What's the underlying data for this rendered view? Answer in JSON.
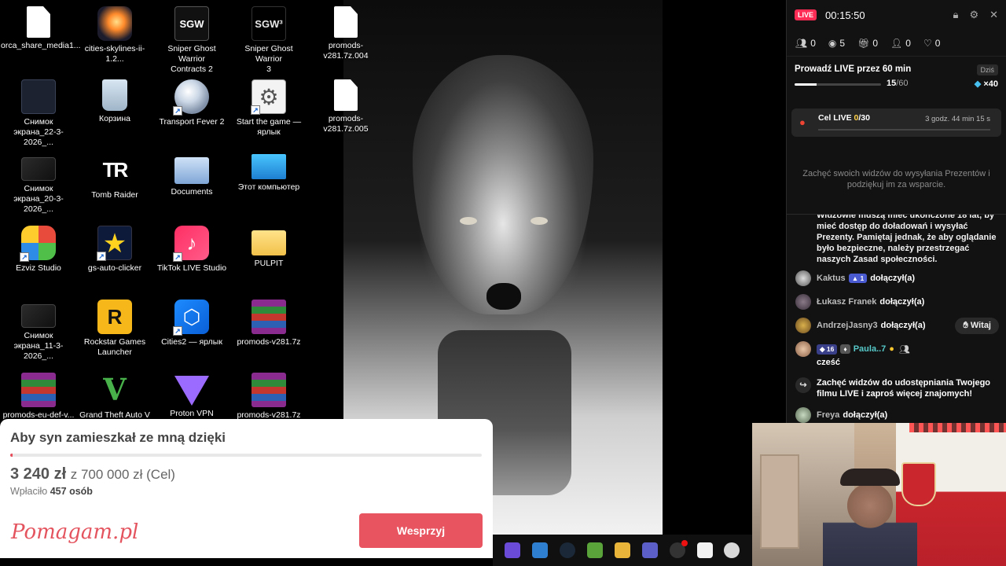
{
  "desktop": {
    "icons": [
      {
        "label": "orca_share_media1..."
      },
      {
        "label": "cities-skylines-ii-1.2..."
      },
      {
        "label": "Sniper Ghost Warrior\nContracts 2",
        "badge": "SGW"
      },
      {
        "label": "Sniper Ghost Warrior\n3",
        "badge": "SGW³"
      },
      {
        "label": "promods-v281.7z.004"
      },
      {
        "label": "Снимок\nэкрана_22-3-2026_..."
      },
      {
        "label": "Корзина"
      },
      {
        "label": "Transport Fever 2"
      },
      {
        "label": "Start the game —\nярлык"
      },
      {
        "label": "promods-v281.7z.005"
      },
      {
        "label": "Снимок\nэкрана_20-3-2026_..."
      },
      {
        "label": "Tomb Raider",
        "badge": "TR"
      },
      {
        "label": "Documents"
      },
      {
        "label": "Этот компьютер"
      },
      {
        "label": "Ezviz Studio"
      },
      {
        "label": "gs-auto-clicker"
      },
      {
        "label": "TikTok LIVE Studio"
      },
      {
        "label": "PULPIT"
      },
      {
        "label": "Снимок\nэкрана_11-3-2026_..."
      },
      {
        "label": "Rockstar Games\nLauncher",
        "badge": "R"
      },
      {
        "label": "Cities2 — ярлык"
      },
      {
        "label": "promods-v281.7z"
      },
      {
        "label": "promods-eu-def-v..."
      },
      {
        "label": "Grand Theft Auto V",
        "badge": "V"
      },
      {
        "label": "Proton VPN"
      },
      {
        "label": "promods-v281.7z"
      }
    ]
  },
  "fundraiser": {
    "title": "Aby syn zamieszkał ze mną dzięki",
    "raised": "3 240 zł",
    "goal": "z 700 000 zł (Cel)",
    "donors_prefix": "Wpłaciło",
    "donors_count": "457",
    "donors_suffix": "osób",
    "progress_fraction": 0.0046,
    "logo": "Pomagam.pl",
    "button": "Wesprzyj",
    "accent": "#e85460"
  },
  "live_panel": {
    "badge": "LIVE",
    "timer": "00:15:50",
    "stats": [
      {
        "icon": "users-icon",
        "value": "0"
      },
      {
        "icon": "eye-icon",
        "value": "5"
      },
      {
        "icon": "gift-icon",
        "value": "0"
      },
      {
        "icon": "user-plus-icon",
        "value": "0"
      },
      {
        "icon": "heart-icon",
        "value": "0"
      }
    ],
    "task": {
      "title": "Prowadź LIVE przez 60 min",
      "today": "Dziś",
      "current": "15",
      "total": "/60",
      "progress_fraction": 0.25,
      "reward": "×40"
    },
    "goal": {
      "label": "Cel LIVE",
      "current": "0",
      "total": "/30",
      "time_left": "3 godz. 44 min 15 s"
    },
    "hint": "Zachęć swoich widzów do wysyłania Prezentów i podziękuj im za wsparcie."
  },
  "chat": {
    "notice": "Widzowie muszą mieć ukończone 18 lat, by mieć dostęp do doładowań i wysyłać Prezenty. Pamiętaj jednak, że aby oglądanie było bezpieczne, należy przestrzegać naszych Zasad społeczności.",
    "joined_text": "dołączył(a)",
    "rows": [
      {
        "name": "Kaktus",
        "badge": "1"
      },
      {
        "name": "Łukasz Franek"
      },
      {
        "name": "AndrzejJasny3",
        "button": "Witaj"
      },
      {
        "name": "Freya"
      }
    ],
    "comment": {
      "badge": "16",
      "badge2": "",
      "name": "Paula..7",
      "text": "cześć"
    },
    "share": "Zachęć widzów do udostępniania Twojego filmu LIVE i zaproś więcej znajomych!"
  },
  "colors": {
    "live_red": "#ff2c55",
    "goal_yellow": "#ffd24a",
    "reward_blue": "#47c0f0"
  }
}
